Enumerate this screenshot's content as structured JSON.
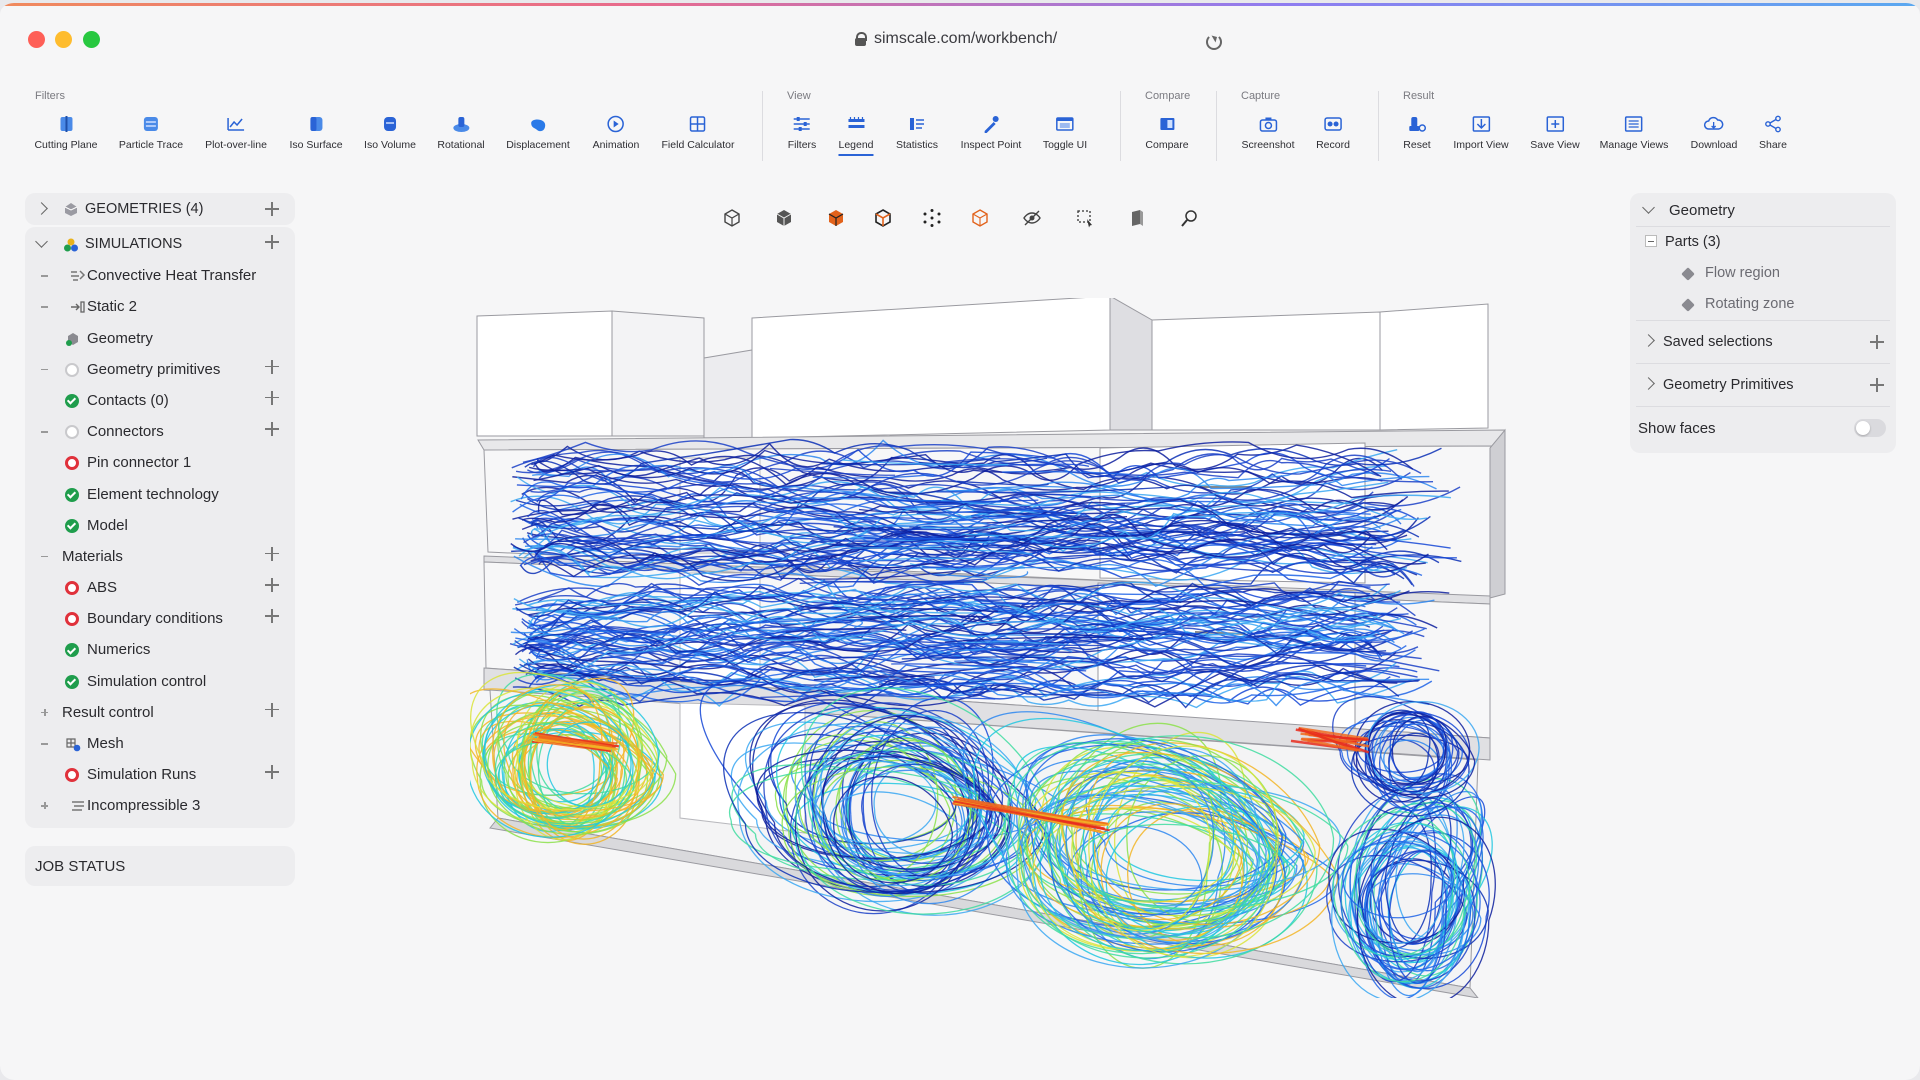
{
  "browser": {
    "url": "simscale.com/workbench/"
  },
  "toolbar": {
    "groups": {
      "filters": "Filters",
      "view": "View",
      "compare": "Compare",
      "capture": "Capture",
      "result": "Result"
    },
    "tools": {
      "cutting_plane": "Cutting Plane",
      "particle_trace": "Particle Trace",
      "plot_over_line": "Plot-over-line",
      "iso_surface": "Iso Surface",
      "iso_volume": "Iso Volume",
      "rotational": "Rotational",
      "displacement": "Displacement",
      "animation": "Animation",
      "field_calculator": "Field Calculator",
      "filters": "Filters",
      "legend": "Legend",
      "statistics": "Statistics",
      "inspect_point": "Inspect Point",
      "toggle_ui": "Toggle UI",
      "compare": "Compare",
      "screenshot": "Screenshot",
      "record": "Record",
      "reset": "Reset",
      "import_view": "Import View",
      "save_view": "Save View",
      "manage_views": "Manage Views",
      "download": "Download",
      "share": "Share"
    },
    "active_tool": "Legend",
    "accent": "#2a63d6"
  },
  "tree": {
    "geometries": "GEOMETRIES (4)",
    "simulations": "SIMULATIONS",
    "items": [
      {
        "label": "Convective Heat Transfer",
        "status": "sim-icon"
      },
      {
        "label": "Static 2",
        "status": "static-icon"
      },
      {
        "label": "Geometry",
        "status": "geometry-icon"
      },
      {
        "label": "Geometry primitives",
        "status": "empty"
      },
      {
        "label": "Contacts (0)",
        "status": "ok"
      },
      {
        "label": "Connectors",
        "status": "empty"
      },
      {
        "label": "Pin connector 1",
        "status": "error"
      },
      {
        "label": "Element technology",
        "status": "ok"
      },
      {
        "label": "Model",
        "status": "ok"
      },
      {
        "label": "Materials",
        "status": "none"
      },
      {
        "label": "ABS",
        "status": "error"
      },
      {
        "label": "Boundary conditions",
        "status": "error"
      },
      {
        "label": "Numerics",
        "status": "ok"
      },
      {
        "label": "Simulation control",
        "status": "ok"
      },
      {
        "label": "Result control",
        "status": "none"
      },
      {
        "label": "Mesh",
        "status": "mesh-icon"
      },
      {
        "label": "Simulation Runs",
        "status": "error"
      },
      {
        "label": "Incompressible 3",
        "status": "incompressible-icon"
      }
    ],
    "status_colors": {
      "ok": "#1f9d4c",
      "error": "#e0313b",
      "empty": "#c9c9cc"
    }
  },
  "job_status": "JOB STATUS",
  "right_panel": {
    "geometry": "Geometry",
    "parts": "Parts (3)",
    "part_items": [
      "Flow region",
      "Rotating zone"
    ],
    "saved_selections": "Saved selections",
    "geometry_primitives": "Geometry Primitives",
    "show_faces": "Show faces",
    "show_faces_on": false
  },
  "view_tools": [
    "iso-view-icon",
    "solid-cube-icon",
    "surfaces-cube-icon",
    "edges-cube-icon",
    "points-cube-icon",
    "wireframe-cube-icon",
    "hide-icon",
    "box-select-icon",
    "transparency-icon",
    "probe-icon"
  ]
}
